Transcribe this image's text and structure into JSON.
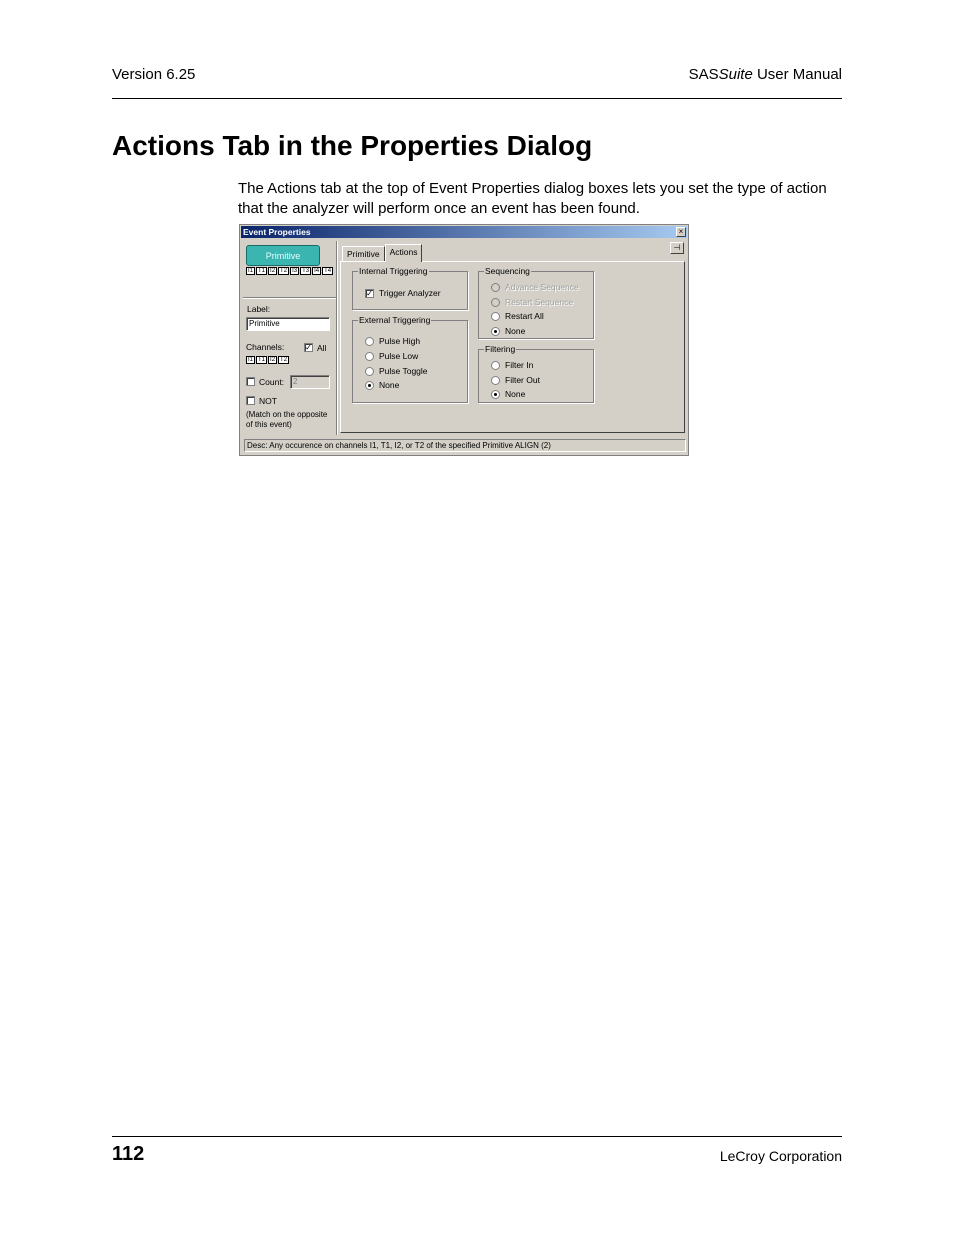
{
  "header": {
    "version": "Version 6.25",
    "manual_prefix": "SAS",
    "manual_italic": "Suite",
    "manual_suffix": " User Manual"
  },
  "section": {
    "title": "Actions Tab in the Properties Dialog",
    "paragraph": "The Actions tab at the top of Event Properties dialog boxes lets you set the type of action that the analyzer will perform once an event has been found."
  },
  "dialog": {
    "title": "Event Properties",
    "close_glyph": "×",
    "primitive_button": "Primitive",
    "channels_top": [
      "I1",
      "T1",
      "I2",
      "T2",
      "I3",
      "T3",
      "I4",
      "T4"
    ],
    "label_caption": "Label:",
    "label_value": "Primitive",
    "channels_caption": "Channels:",
    "all_label": "All",
    "channels_bottom": [
      "I1",
      "T1",
      "I2",
      "T2"
    ],
    "count_label": "Count:",
    "count_value": "2",
    "not_label": "NOT",
    "match_note_1": "(Match on the opposite",
    "match_note_2": "of this event)",
    "tabs": [
      {
        "label": "Primitive"
      },
      {
        "label": "Actions"
      }
    ],
    "internal_triggering": {
      "title": "Internal Triggering",
      "trigger_analyzer": "Trigger Analyzer"
    },
    "external_triggering": {
      "title": "External Triggering",
      "options": [
        "Pulse High",
        "Pulse Low",
        "Pulse Toggle",
        "None"
      ],
      "selected": "None"
    },
    "sequencing": {
      "title": "Sequencing",
      "options": [
        "Advance Sequence",
        "Restart Sequence",
        "Restart All",
        "None"
      ],
      "selected": "None"
    },
    "filtering": {
      "title": "Filtering",
      "options": [
        "Filter In",
        "Filter Out",
        "None"
      ],
      "selected": "None"
    },
    "description": "Desc: Any occurence on channels I1, T1, I2, or T2 of the specified Primitive ALIGN (2)"
  },
  "footer": {
    "page_number": "112",
    "company": "LeCroy Corporation"
  }
}
